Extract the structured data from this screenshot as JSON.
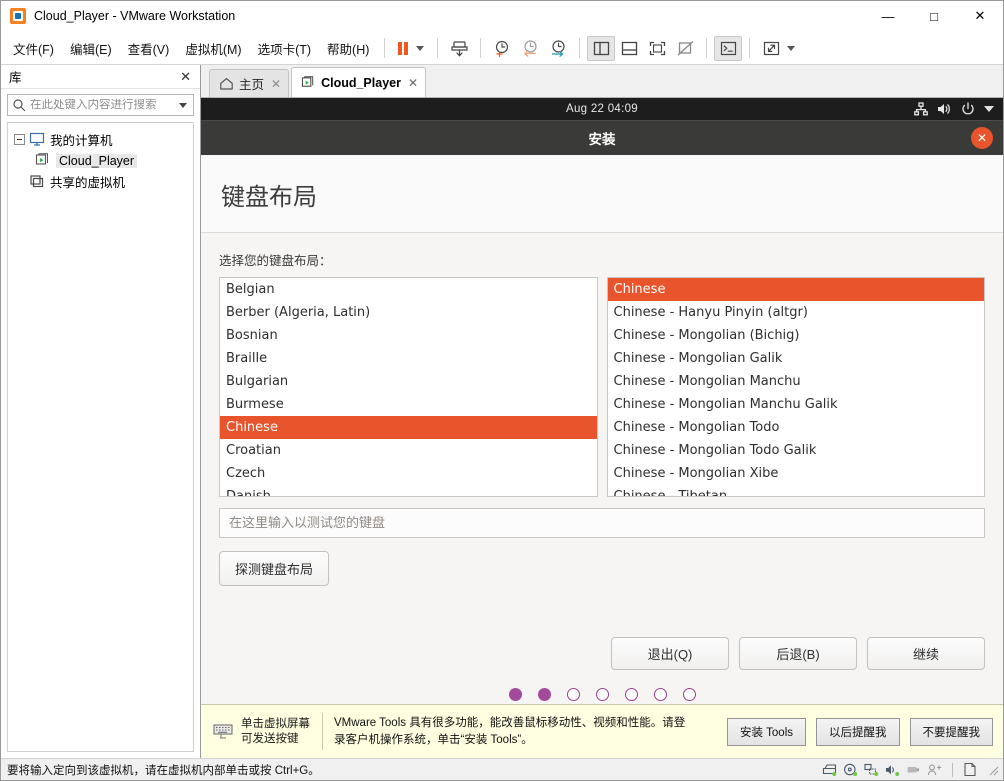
{
  "window": {
    "title": "Cloud_Player - VMware Workstation",
    "app_icon": "vmware-logo-icon",
    "minimize_label": "—",
    "maximize_label": "□",
    "close_label": "✕"
  },
  "menubar": {
    "items": [
      {
        "label": "文件(F)",
        "name": "menu-file"
      },
      {
        "label": "编辑(E)",
        "name": "menu-edit"
      },
      {
        "label": "查看(V)",
        "name": "menu-view"
      },
      {
        "label": "虚拟机(M)",
        "name": "menu-vm"
      },
      {
        "label": "选项卡(T)",
        "name": "menu-tabs"
      },
      {
        "label": "帮助(H)",
        "name": "menu-help"
      }
    ]
  },
  "toolbar": {
    "buttons": [
      {
        "name": "pause-button",
        "icon": "pause-icon"
      },
      {
        "name": "power-dropdown",
        "icon": "chevron-down-icon"
      },
      {
        "name": "snapshot-button",
        "icon": "snapshot-icon"
      },
      {
        "name": "take-snapshot-button",
        "icon": "clock-plus-icon"
      },
      {
        "name": "revert-snapshot-button",
        "icon": "clock-back-icon"
      },
      {
        "name": "snapshot-manager-button",
        "icon": "clock-wrench-icon"
      },
      {
        "name": "show-library-button",
        "icon": "panel-left-icon"
      },
      {
        "name": "show-thumbnails-button",
        "icon": "panel-bottom-icon"
      },
      {
        "name": "full-screen-button",
        "icon": "fullscreen-frame-icon"
      },
      {
        "name": "unity-mode-button",
        "icon": "unity-off-icon"
      },
      {
        "name": "console-button",
        "icon": "terminal-icon"
      },
      {
        "name": "stretch-button",
        "icon": "expand-arrows-icon"
      },
      {
        "name": "stretch-dropdown",
        "icon": "chevron-down-icon"
      }
    ]
  },
  "sidebar": {
    "header_title": "库",
    "close_label": "✕",
    "search": {
      "placeholder": "在此处键入内容进行搜索",
      "value": "",
      "icon": "search-icon"
    },
    "tree": [
      {
        "label": "我的计算机",
        "name": "tree-item-my-computer",
        "icon": "monitor-icon",
        "level": 0,
        "expanded": true,
        "selected": false
      },
      {
        "label": "Cloud_Player",
        "name": "tree-item-cloud-player",
        "icon": "vm-running-icon",
        "level": 1,
        "expanded": false,
        "selected": true
      },
      {
        "label": "共享的虚拟机",
        "name": "tree-item-shared-vms",
        "icon": "shared-vm-icon",
        "level": 0,
        "expanded": false,
        "selected": false
      }
    ]
  },
  "tabs": [
    {
      "label": "主页",
      "name": "tab-home",
      "icon": "home-icon",
      "active": false,
      "close_label": "✕"
    },
    {
      "label": "Cloud_Player",
      "name": "tab-cloud-player",
      "icon": "vm-running-icon",
      "active": true,
      "close_label": "✕"
    }
  ],
  "guest": {
    "topbar": {
      "clock": "Aug 22  04:09",
      "icons": [
        {
          "name": "network-icon"
        },
        {
          "name": "volume-icon"
        },
        {
          "name": "power-icon"
        },
        {
          "name": "chevron-down-icon"
        }
      ]
    },
    "installer": {
      "window_title": "安装",
      "close_label": "✕",
      "heading": "键盘布局",
      "field_label": "选择您的键盘布局：",
      "layouts_left": [
        {
          "label": "Belgian",
          "selected": false
        },
        {
          "label": "Berber (Algeria, Latin)",
          "selected": false
        },
        {
          "label": "Bosnian",
          "selected": false
        },
        {
          "label": "Braille",
          "selected": false
        },
        {
          "label": "Bulgarian",
          "selected": false
        },
        {
          "label": "Burmese",
          "selected": false
        },
        {
          "label": "Chinese",
          "selected": true
        },
        {
          "label": "Croatian",
          "selected": false
        },
        {
          "label": "Czech",
          "selected": false
        },
        {
          "label": "Danish",
          "selected": false
        }
      ],
      "layouts_right": [
        {
          "label": "Chinese",
          "selected": true
        },
        {
          "label": "Chinese - Hanyu Pinyin (altgr)",
          "selected": false
        },
        {
          "label": "Chinese - Mongolian (Bichig)",
          "selected": false
        },
        {
          "label": "Chinese - Mongolian Galik",
          "selected": false
        },
        {
          "label": "Chinese - Mongolian Manchu",
          "selected": false
        },
        {
          "label": "Chinese - Mongolian Manchu Galik",
          "selected": false
        },
        {
          "label": "Chinese - Mongolian Todo",
          "selected": false
        },
        {
          "label": "Chinese - Mongolian Todo Galik",
          "selected": false
        },
        {
          "label": "Chinese - Mongolian Xibe",
          "selected": false
        },
        {
          "label": "Chinese - Tibetan",
          "selected": false
        }
      ],
      "test_input": {
        "placeholder": "在这里输入以测试您的键盘",
        "value": ""
      },
      "detect_button": "探测键盘布局",
      "nav_buttons": [
        {
          "label": "退出(Q)",
          "name": "quit-button"
        },
        {
          "label": "后退(B)",
          "name": "back-button"
        },
        {
          "label": "继续",
          "name": "continue-button"
        }
      ],
      "progress_dots": {
        "total": 7,
        "filled": 2
      },
      "accent_color": "#e8552d",
      "dot_color": "#a44a9b"
    }
  },
  "tools_notification": {
    "keyboard_icon": "keyboard-icon",
    "hint_line1": "单击虚拟屏幕",
    "hint_line2": "可发送按键",
    "message_line1": "VMware Tools 具有很多功能，能改善鼠标移动性、视频和性能。请登",
    "message_line2": "录客户机操作系统，单击“安装 Tools”。",
    "buttons": [
      {
        "label": "安装 Tools",
        "name": "install-tools-button"
      },
      {
        "label": "以后提醒我",
        "name": "remind-later-button"
      },
      {
        "label": "不要提醒我",
        "name": "never-remind-button"
      }
    ]
  },
  "statusbar": {
    "message": "要将输入定向到该虚拟机，请在虚拟机内部单击或按 Ctrl+G。",
    "devices": [
      {
        "name": "hard-disk-icon"
      },
      {
        "name": "cd-dvd-icon"
      },
      {
        "name": "network-adapter-icon"
      },
      {
        "name": "sound-card-icon"
      },
      {
        "name": "usb-device-icon"
      },
      {
        "name": "user-session-icon"
      },
      {
        "name": "document-icon"
      }
    ]
  }
}
